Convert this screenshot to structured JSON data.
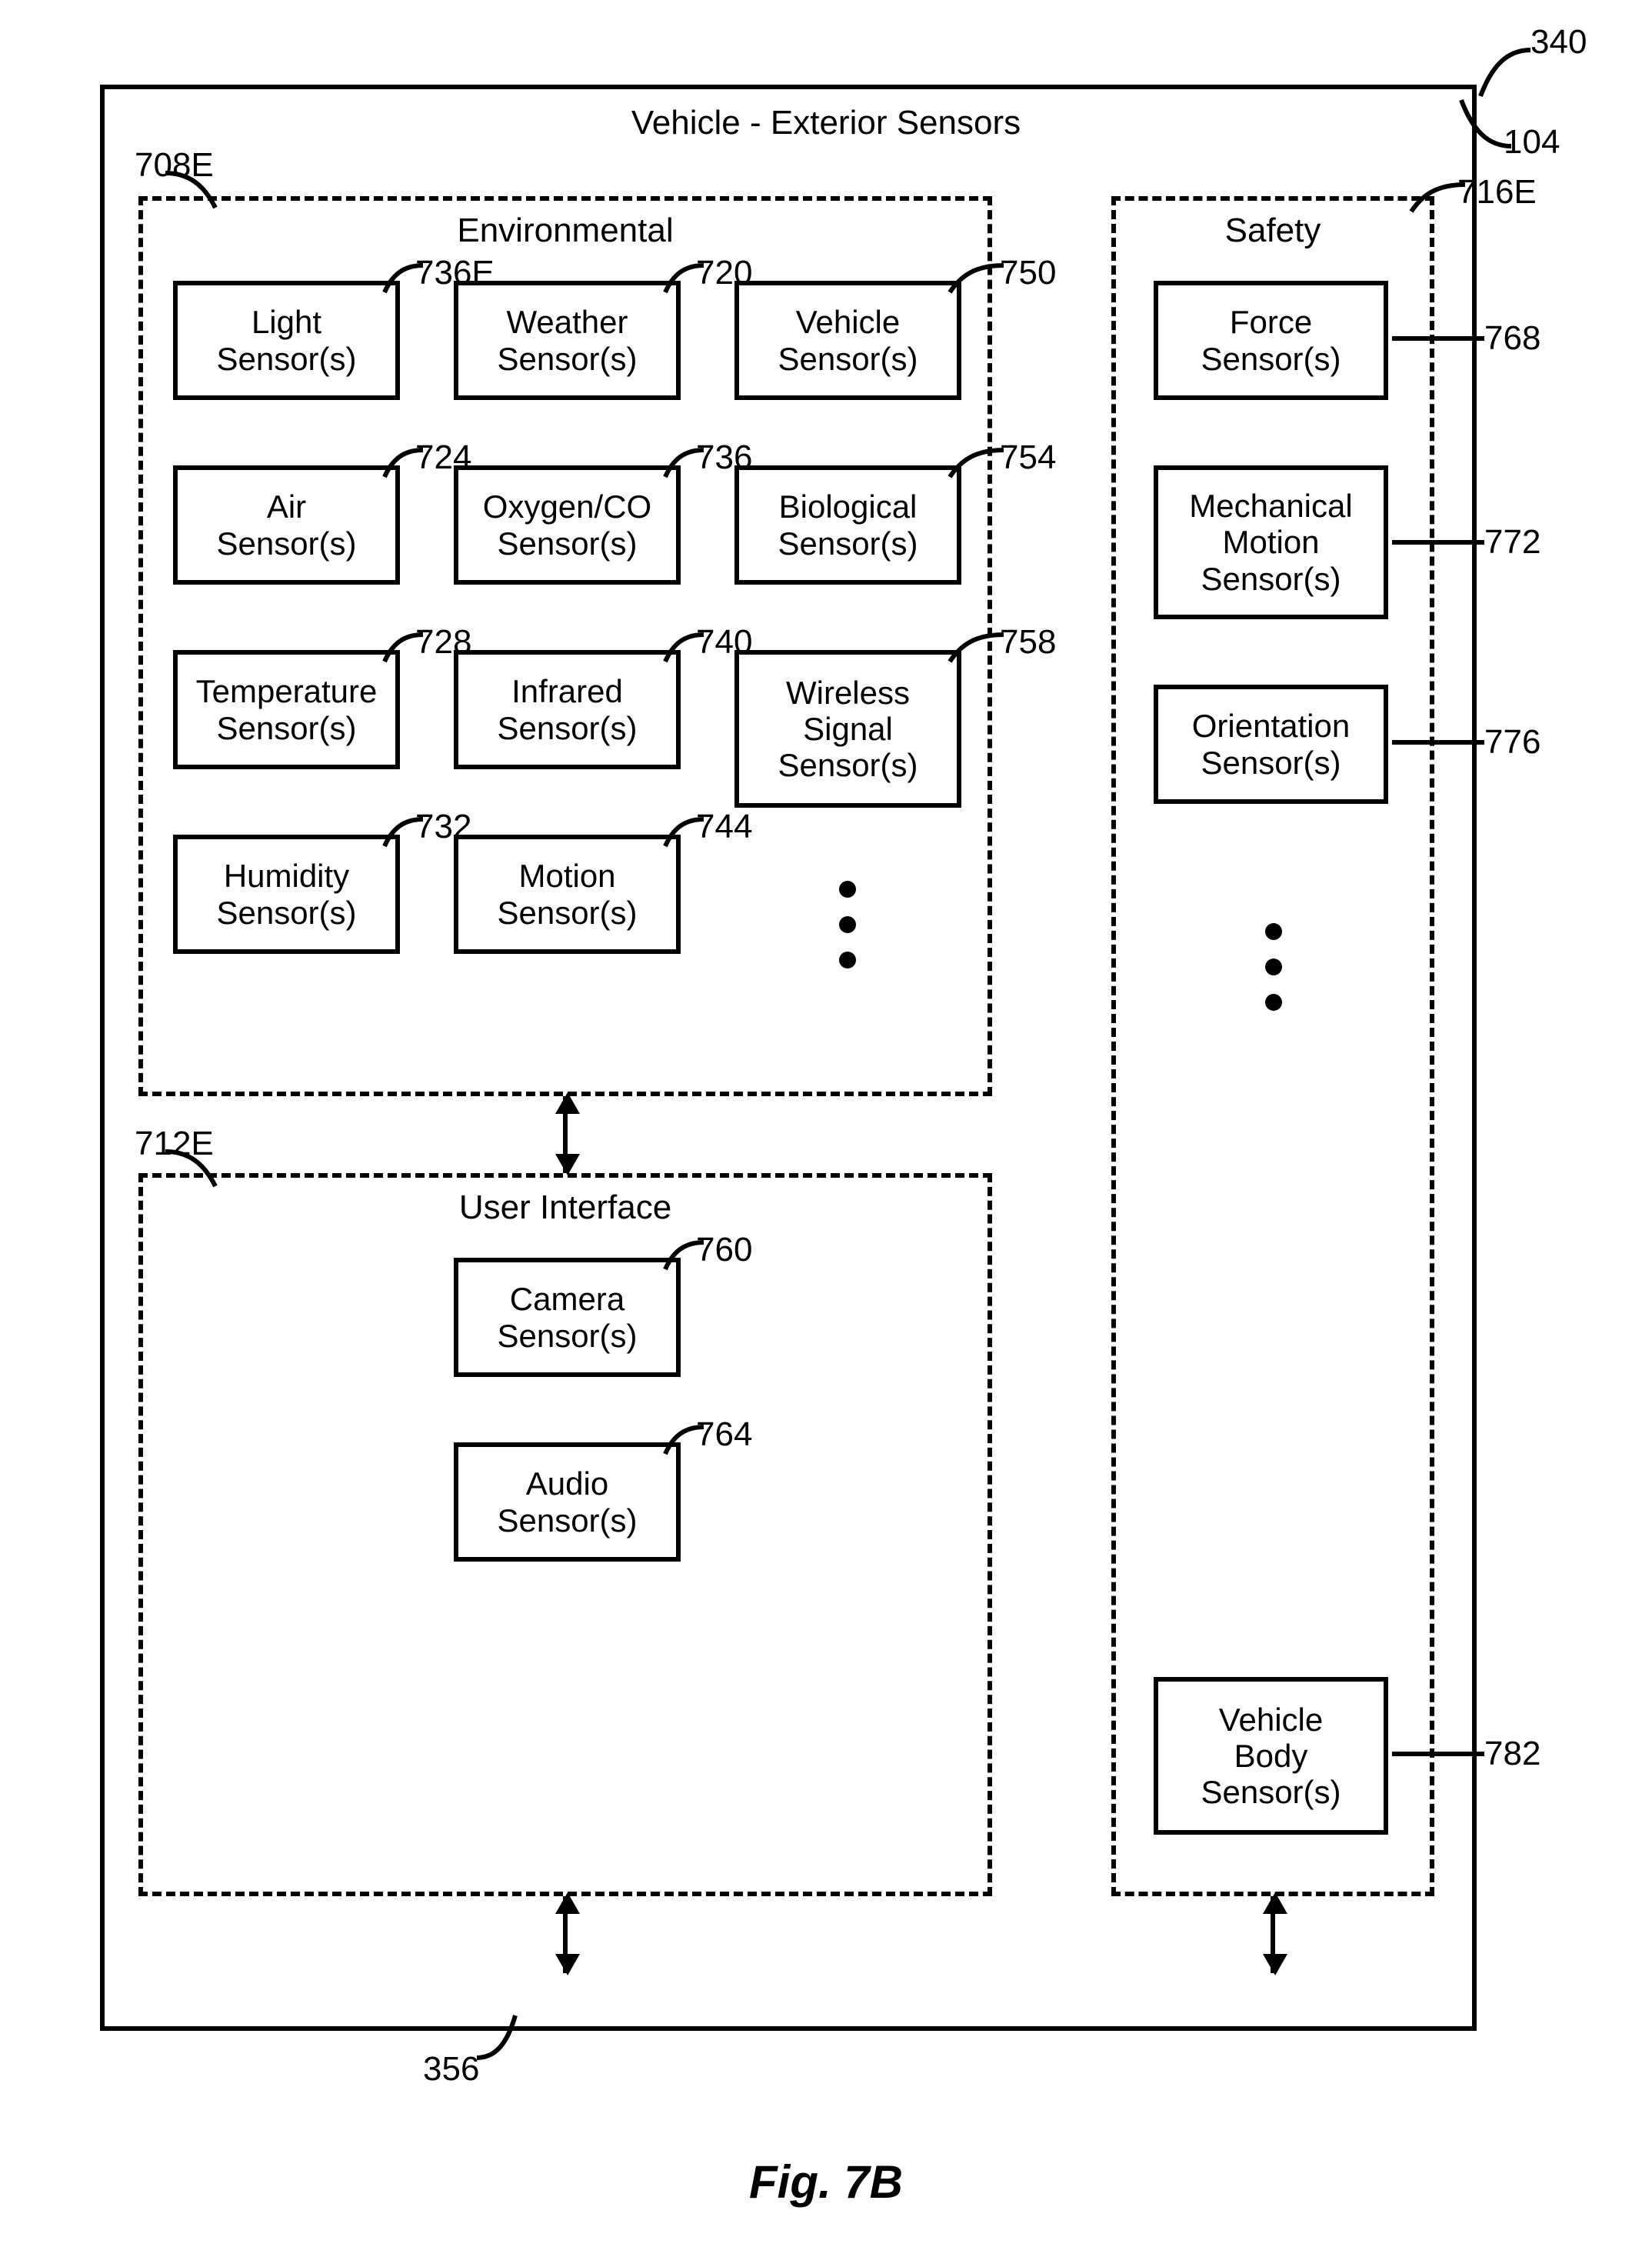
{
  "figure_label": "Fig. 7B",
  "outer": {
    "title": "Vehicle - Exterior Sensors",
    "ref": "104"
  },
  "top_ref": "340",
  "bus_ref": "356",
  "groups": {
    "environmental": {
      "title": "Environmental",
      "ref": "708E"
    },
    "user_interface": {
      "title": "User Interface",
      "ref": "712E"
    },
    "safety": {
      "title": "Safety",
      "ref": "716E"
    }
  },
  "blocks": {
    "b708a": {
      "l1": "Light",
      "l2": "Sensor(s)",
      "ref": "736E"
    },
    "b708b": {
      "l1": "Air",
      "l2": "Sensor(s)",
      "ref": "724"
    },
    "b708c": {
      "l1": "Temperature",
      "l2": "Sensor(s)",
      "ref": "728"
    },
    "b708d": {
      "l1": "Humidity",
      "l2": "Sensor(s)",
      "ref": "732"
    },
    "b708e": {
      "l1": "Weather",
      "l2": "Sensor(s)",
      "ref": "720"
    },
    "b708f": {
      "l1": "Oxygen/CO",
      "l2": "Sensor(s)",
      "ref": "736"
    },
    "b740": {
      "l1": "Infrared",
      "l2": "Sensor(s)",
      "ref": "740"
    },
    "b744": {
      "l1": "Motion",
      "l2": "Sensor(s)",
      "ref": "744"
    },
    "b760": {
      "l1": "Camera",
      "l2": "Sensor(s)",
      "ref": "760"
    },
    "b764": {
      "l1": "Audio",
      "l2": "Sensor(s)",
      "ref": "764"
    },
    "b750": {
      "l1": "Vehicle",
      "l2": "Sensor(s)",
      "ref": "750"
    },
    "b754": {
      "l1": "Biological",
      "l2": "Sensor(s)",
      "ref": "754"
    },
    "b758": {
      "l1": "Wireless",
      "l2": "Signal",
      "l3": "Sensor(s)",
      "ref": "758"
    },
    "b768": {
      "l1": "Force",
      "l2": "Sensor(s)",
      "ref": "768"
    },
    "b772": {
      "l1": "Mechanical",
      "l2": "Motion",
      "l3": "Sensor(s)",
      "ref": "772"
    },
    "b776": {
      "l1": "Orientation",
      "l2": "Sensor(s)",
      "ref": "776"
    },
    "b782": {
      "l1": "Vehicle",
      "l2": "Body",
      "l3": "Sensor(s)",
      "ref": "782"
    }
  }
}
